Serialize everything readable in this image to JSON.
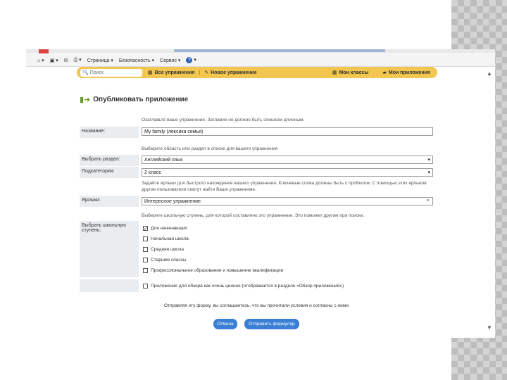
{
  "cmdbar": {
    "page_menu": "Страница ▾",
    "security_menu": "Безопасность ▾",
    "service_menu": "Сервис ▾",
    "help_glyph": "?"
  },
  "nav": {
    "search_placeholder": "Поиск",
    "all_exercises": "Все упражнения",
    "new_exercise": "Новое упражнение",
    "my_classes": "Мои классы",
    "my_apps": "Мои приложения"
  },
  "form": {
    "title": "Опубликовать приложение",
    "name_hint": "Озаглавьте ваше упражнение. Заглавие не должно быть слишком длинным.",
    "name_label": "Название:",
    "name_value": "My family (лексика семья)",
    "section_hint": "Выберите область или раздел в списке для вашего упражнения",
    "section_label": "Выбрать раздел:",
    "section_value": "Английский язык",
    "subcategory_label": "Подкатегория:",
    "subcategory_value": "2 класс",
    "tags_hint_1": "Задайте ярлыки для быстрого нахождения вашего упражнения. Ключевые слова должны быть с пробелом. С помощью этих ярлыков",
    "tags_hint_2": "другие пользователи смогут найти Ваше упражнение.",
    "tags_label": "Ярлыки:",
    "tags_value": "Интересное упражнение",
    "level_hint": "Выберите школьную ступень, для которой составлено это упражнение. Это поможет другим при поиске.",
    "level_label": "Выбрать школьную ступень:",
    "levels": [
      {
        "label": "Для начинающих",
        "checked": true
      },
      {
        "label": "Начальная школа",
        "checked": false
      },
      {
        "label": "Средняя школа",
        "checked": false
      },
      {
        "label": "Старшие классы",
        "checked": false
      },
      {
        "label": "Профессиональное образование и повышение квалификации",
        "checked": false
      }
    ],
    "valuable_label": "Приложение для обзора как очень ценное (отображается в разделе «Обзор приложений»)",
    "agree_text": "Отправляя эту форму, вы соглашаетесь, что вы прочитали условия и согласны с ними.",
    "cancel_label": "Отмена",
    "submit_label": "Отправить формуляр"
  }
}
